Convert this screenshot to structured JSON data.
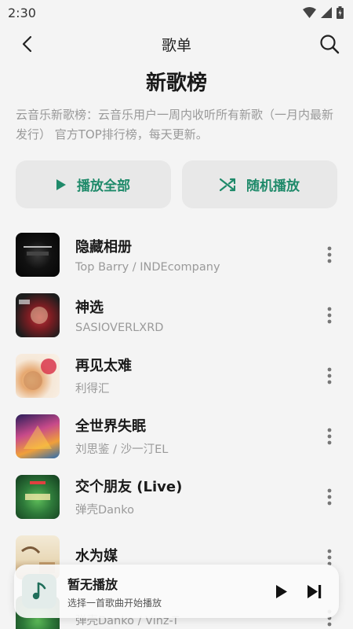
{
  "status_bar": {
    "time": "2:30"
  },
  "header": {
    "title": "歌单"
  },
  "playlist": {
    "title": "新歌榜",
    "description": "云音乐新歌榜：云音乐用户一周内收听所有新歌（一月内最新发行） 官方TOP排行榜，每天更新。"
  },
  "actions": {
    "play_all": "播放全部",
    "shuffle": "随机播放"
  },
  "songs": [
    {
      "title": "隐藏相册",
      "artist": "Top Barry / INDEcompany"
    },
    {
      "title": "神选",
      "artist": "SASIOVERLXRD"
    },
    {
      "title": "再见太难",
      "artist": "利得汇"
    },
    {
      "title": "全世界失眠",
      "artist": "刘思鉴 / 沙一汀EL"
    },
    {
      "title": "交个朋友 (Live)",
      "artist": "弹壳Danko"
    },
    {
      "title": "水为媒",
      "artist": ""
    },
    {
      "title": "",
      "artist": "弹壳Danko / Vinz-T"
    }
  ],
  "mini_player": {
    "title": "暂无播放",
    "subtitle": "选择一首歌曲开始播放"
  },
  "colors": {
    "accent": "#1f8a6a",
    "background": "#f4f4f4"
  }
}
